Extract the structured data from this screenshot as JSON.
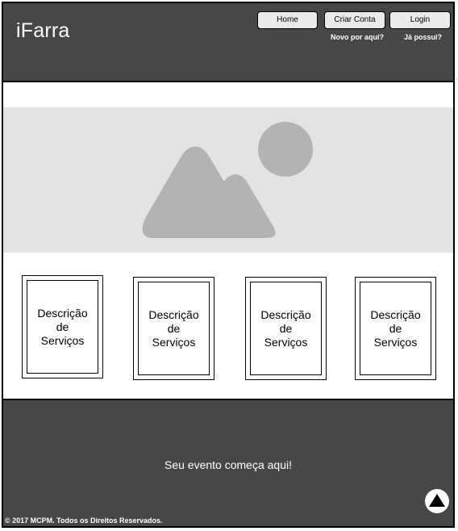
{
  "header": {
    "logo": "iFarra",
    "nav": [
      {
        "label": "Home",
        "note": ""
      },
      {
        "label": "Criar Conta",
        "note": "Novo por aqui?"
      },
      {
        "label": "Login",
        "note": "Já possui?"
      }
    ]
  },
  "hero": {
    "icon": "image-placeholder-icon"
  },
  "services": [
    {
      "label": "Descrição\nde\nServiços"
    },
    {
      "label": "Descrição\nde\nServiços"
    },
    {
      "label": "Descrição\nde\nServiços"
    },
    {
      "label": "Descrição\nde\nServiços"
    }
  ],
  "footer": {
    "tagline": "Seu evento começa aqui!",
    "copyright": "© 2017 MCPM. Todos os Direitos Reservados.",
    "scroll_top_icon": "arrow-up-circle-icon"
  },
  "colors": {
    "header_bg": "#474747",
    "hero_bg": "#e3e3e3",
    "placeholder_gray": "#b3b3b3",
    "button_bg": "#eaeaea"
  }
}
